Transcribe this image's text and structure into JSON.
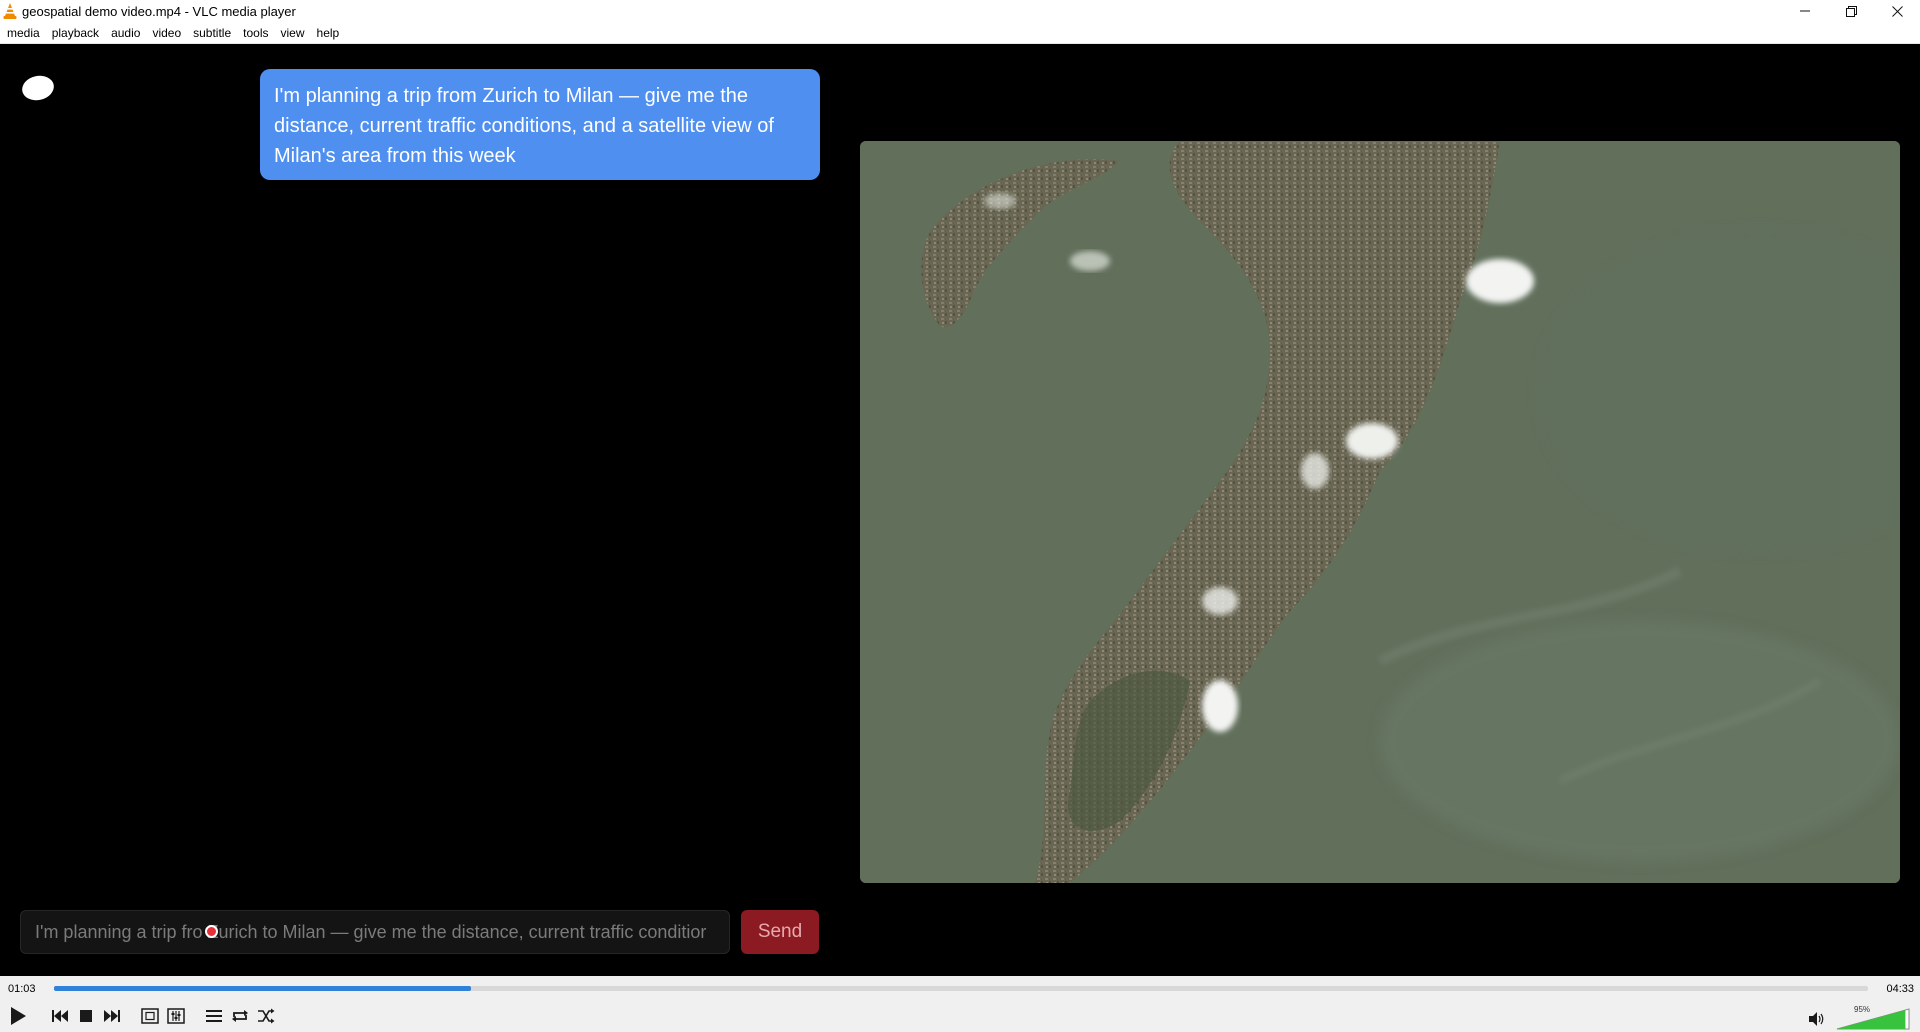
{
  "window": {
    "title": "geospatial demo video.mp4 - VLC media player",
    "minimize_icon": "minimize-icon",
    "maximize_icon": "restore-icon",
    "close_icon": "close-icon"
  },
  "menu": {
    "items": [
      "media",
      "playback",
      "audio",
      "video",
      "subtitle",
      "tools",
      "view",
      "help"
    ]
  },
  "video_frame": {
    "chat_bubble": "I'm planning a trip from Zurich to Milan — give me the distance, current traffic conditions, and a satellite view of Milan's area from this week",
    "input_value": "I'm planning a trip fro Zurich to Milan — give me the distance, current traffic conditior",
    "send_label": "Send",
    "bubble_color": "#4f8ff0",
    "send_color": "#8b1a22"
  },
  "player": {
    "elapsed": "01:03",
    "total": "04:33",
    "progress": 0.23,
    "volume_label": "95%",
    "volume": 0.95,
    "accent_color": "#2f82d8",
    "buttons": [
      "play-icon",
      "previous-icon",
      "stop-icon",
      "next-icon",
      "fullscreen-icon",
      "extended-settings-icon",
      "playlist-icon",
      "loop-icon",
      "shuffle-icon",
      "speaker-icon"
    ]
  }
}
